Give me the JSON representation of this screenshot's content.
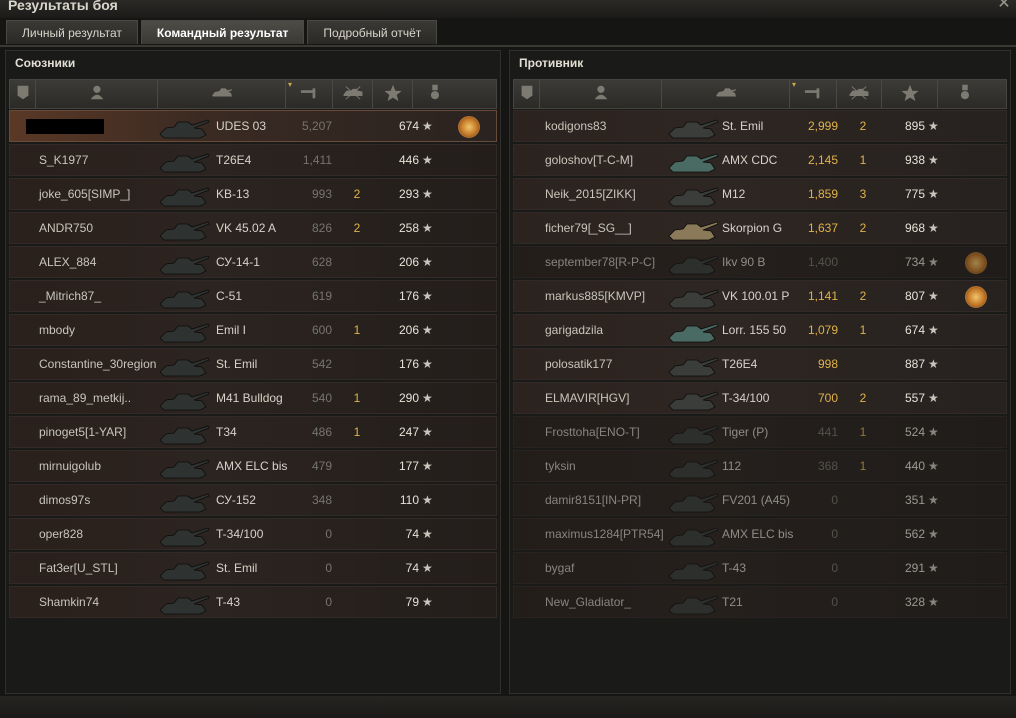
{
  "window": {
    "title": "Результаты боя",
    "close_glyph": "✕"
  },
  "tabs": [
    {
      "label": "Личный результат",
      "active": false
    },
    {
      "label": "Командный результат",
      "active": true
    },
    {
      "label": "Подробный отчёт",
      "active": false
    }
  ],
  "header_icons": [
    "tank-level-icon",
    "player-icon",
    "vehicle-icon",
    "damage-icon",
    "kills-icon",
    "xp-star-icon",
    "medal-icon"
  ],
  "allies": {
    "title": "Союзники",
    "rows": [
      {
        "player": "",
        "tank": "UDES 03",
        "damage": "5,207",
        "kills": "",
        "xp": "674",
        "medal": true,
        "own": true
      },
      {
        "player": "S_K1977",
        "tank": "T26E4",
        "damage": "1,411",
        "kills": "",
        "xp": "446",
        "medal": false
      },
      {
        "player": "joke_605[SIMP_]",
        "tank": "KB-13",
        "damage": "993",
        "kills": "2",
        "xp": "293",
        "medal": false
      },
      {
        "player": "ANDR750",
        "tank": "VK 45.02 A",
        "damage": "826",
        "kills": "2",
        "xp": "258",
        "medal": false
      },
      {
        "player": "ALEX_884",
        "tank": "СУ-14-1",
        "damage": "628",
        "kills": "",
        "xp": "206",
        "medal": false
      },
      {
        "player": "_Mitrich87_",
        "tank": "С-51",
        "damage": "619",
        "kills": "",
        "xp": "176",
        "medal": false
      },
      {
        "player": "mbody",
        "tank": "Emil I",
        "damage": "600",
        "kills": "1",
        "xp": "206",
        "medal": false
      },
      {
        "player": "Constantine_30region",
        "tank": "St. Emil",
        "damage": "542",
        "kills": "",
        "xp": "176",
        "medal": false
      },
      {
        "player": "rama_89_metkij..",
        "tank": "M41 Bulldog",
        "damage": "540",
        "kills": "1",
        "xp": "290",
        "medal": false
      },
      {
        "player": "pinoget5[1-YAR]",
        "tank": "T34",
        "damage": "486",
        "kills": "1",
        "xp": "247",
        "medal": false
      },
      {
        "player": "mirnuigolub",
        "tank": "AMX ELC bis",
        "damage": "479",
        "kills": "",
        "xp": "177",
        "medal": false
      },
      {
        "player": "dimos97s",
        "tank": "СУ-152",
        "damage": "348",
        "kills": "",
        "xp": "110",
        "medal": false
      },
      {
        "player": "oper828",
        "tank": "T-34/100",
        "damage": "0",
        "kills": "",
        "xp": "74",
        "medal": false
      },
      {
        "player": "Fat3er[U_STL]",
        "tank": "St. Emil",
        "damage": "0",
        "kills": "",
        "xp": "74",
        "medal": false
      },
      {
        "player": "Shamkin74",
        "tank": "T-43",
        "damage": "0",
        "kills": "",
        "xp": "79",
        "medal": false
      }
    ]
  },
  "enemies": {
    "title": "Противник",
    "rows": [
      {
        "player": "kodigons83",
        "tank": "St. Emil",
        "damage": "2,999",
        "kills": "2",
        "xp": "895",
        "medal": false,
        "alive": true
      },
      {
        "player": "goloshov[T-C-M]",
        "tank": "AMX CDC",
        "damage": "2,145",
        "kills": "1",
        "xp": "938",
        "medal": false,
        "alive": true
      },
      {
        "player": "Neik_2015[ZIKK]",
        "tank": "M12",
        "damage": "1,859",
        "kills": "3",
        "xp": "775",
        "medal": false,
        "alive": true
      },
      {
        "player": "ficher79[_SG__]",
        "tank": "Skorpion G",
        "damage": "1,637",
        "kills": "2",
        "xp": "968",
        "medal": false,
        "alive": true
      },
      {
        "player": "september78[R-P-C]",
        "tank": "Ikv 90 B",
        "damage": "1,400",
        "kills": "",
        "xp": "734",
        "medal": true,
        "alive": false
      },
      {
        "player": "markus885[KMVP]",
        "tank": "VK 100.01 P",
        "damage": "1,141",
        "kills": "2",
        "xp": "807",
        "medal": true,
        "alive": true
      },
      {
        "player": "garigadzila",
        "tank": "Lorr. 155 50",
        "damage": "1,079",
        "kills": "1",
        "xp": "674",
        "medal": false,
        "alive": true
      },
      {
        "player": "polosatik177",
        "tank": "T26E4",
        "damage": "998",
        "kills": "",
        "xp": "887",
        "medal": false,
        "alive": true
      },
      {
        "player": "ELMAVIR[HGV]",
        "tank": "T-34/100",
        "damage": "700",
        "kills": "2",
        "xp": "557",
        "medal": false,
        "alive": true
      },
      {
        "player": "Frosttoha[ENO-T]",
        "tank": "Tiger (P)",
        "damage": "441",
        "kills": "1",
        "xp": "524",
        "medal": false,
        "alive": false
      },
      {
        "player": "tyksin",
        "tank": "112",
        "damage": "368",
        "kills": "1",
        "xp": "440",
        "medal": false,
        "alive": false
      },
      {
        "player": "damir8151[IN-PR]",
        "tank": "FV201 (A45)",
        "damage": "0",
        "kills": "",
        "xp": "351",
        "medal": false,
        "alive": false
      },
      {
        "player": "maximus1284[PTR54]",
        "tank": "AMX ELC bis",
        "damage": "0",
        "kills": "",
        "xp": "562",
        "medal": false,
        "alive": false
      },
      {
        "player": "bygaf",
        "tank": "T-43",
        "damage": "0",
        "kills": "",
        "xp": "291",
        "medal": false,
        "alive": false
      },
      {
        "player": "New_Gladiator_",
        "tank": "T21",
        "damage": "0",
        "kills": "",
        "xp": "328",
        "medal": false,
        "alive": false
      }
    ]
  },
  "star_glyph": "★",
  "sort_glyph": "▾"
}
